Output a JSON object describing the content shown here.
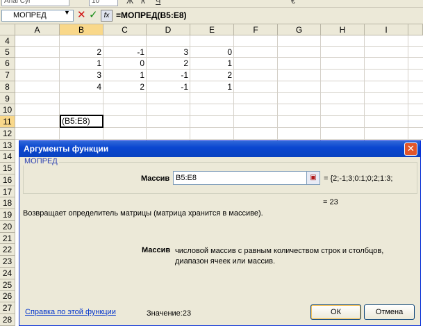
{
  "toolbar": {
    "font_name": "Arial Cyr",
    "font_size": "10",
    "glyphs": [
      "Ж",
      "К",
      "Ч",
      "€"
    ]
  },
  "formula_bar": {
    "name_box": "МОПРЕД",
    "cancel_icon": "cancel-x-icon",
    "enter_icon": "checkmark-icon",
    "fx_label": "fx",
    "formula": "=МОПРЕД(B5:E8)"
  },
  "columns": [
    "A",
    "B",
    "C",
    "D",
    "E",
    "F",
    "G",
    "H",
    "I"
  ],
  "rows": [
    "4",
    "5",
    "6",
    "7",
    "8",
    "9",
    "10",
    "11",
    "12",
    "13",
    "14",
    "15",
    "16",
    "17",
    "18",
    "19",
    "20",
    "21",
    "22",
    "23",
    "24",
    "25",
    "26",
    "27",
    "28"
  ],
  "cells": {
    "r5": [
      "2",
      "-1",
      "3",
      "0"
    ],
    "r6": [
      "1",
      "0",
      "2",
      "1"
    ],
    "r7": [
      "3",
      "1",
      "-1",
      "2"
    ],
    "r8": [
      "4",
      "2",
      "-1",
      "1"
    ],
    "b11": "(B5:E8)"
  },
  "dialog": {
    "title": "Аргументы функции",
    "function_name": "МОПРЕД",
    "arg_label": "Массив",
    "arg_value": "B5:E8",
    "arg_eval": "= {2;-1;3;0:1;0;2;1:3;",
    "result": "= 23",
    "description": "Возвращает определитель матрицы (матрица хранится в массиве).",
    "param_name": "Массив",
    "param_description": "числовой массив с равным количеством строк и столбцов, диапазон ячеек или массив.",
    "help_link": "Справка по этой функции",
    "value_label": "Значение:",
    "value": "23",
    "ok_label": "ОК",
    "cancel_label": "Отмена",
    "close_icon": "close-x-icon"
  }
}
